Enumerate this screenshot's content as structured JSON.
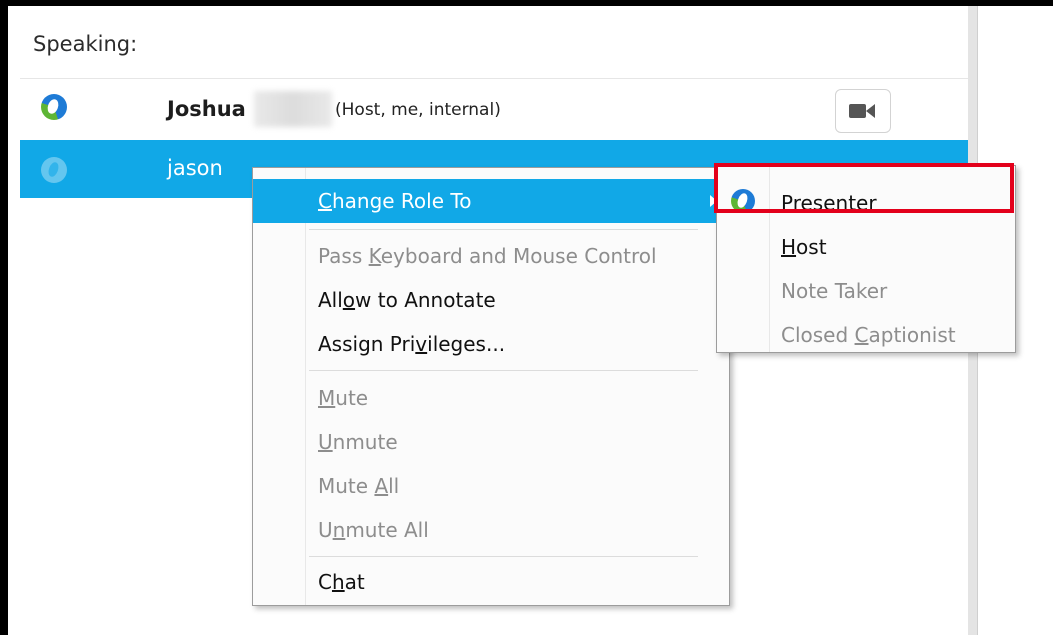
{
  "panel": {
    "heading": "Speaking:"
  },
  "participants": [
    {
      "name": "Joshua",
      "tag": "(Host, me, internal)",
      "status_icon": "webex-presenter-icon",
      "video_icon": "video-camera-icon"
    },
    {
      "name": "jason",
      "status_icon": "webex-attendee-icon",
      "selected": true
    }
  ],
  "context_menu": {
    "items": [
      {
        "key": "change_role",
        "label": "Change Role To",
        "mnemonic_index": 0,
        "enabled": true,
        "has_submenu": true,
        "highlighted": true
      },
      {
        "key": "pass_control",
        "label": "Pass Keyboard and Mouse Control",
        "mnemonic_index": 5,
        "enabled": false
      },
      {
        "key": "allow_annotate",
        "label": "Allow to Annotate",
        "mnemonic_index": 3,
        "enabled": true
      },
      {
        "key": "assign_privileges",
        "label": "Assign Privileges...",
        "mnemonic_index": 10,
        "enabled": true
      },
      {
        "key": "mute",
        "label": "Mute",
        "mnemonic_index": 0,
        "enabled": false
      },
      {
        "key": "unmute",
        "label": "Unmute",
        "mnemonic_index": 0,
        "enabled": false
      },
      {
        "key": "mute_all",
        "label": "Mute All",
        "mnemonic_index": 5,
        "enabled": false
      },
      {
        "key": "unmute_all",
        "label": "Unmute All",
        "mnemonic_index": 1,
        "enabled": false
      },
      {
        "key": "chat",
        "label": "Chat",
        "mnemonic_index": 1,
        "enabled": true
      }
    ]
  },
  "role_submenu": {
    "items": [
      {
        "key": "presenter",
        "label": "Presenter",
        "mnemonic_index": 0,
        "enabled": true,
        "icon": "webex-presenter-icon",
        "highlighted_callout": true
      },
      {
        "key": "host",
        "label": "Host",
        "mnemonic_index": 0,
        "enabled": true
      },
      {
        "key": "note_taker",
        "label": "Note Taker",
        "mnemonic_index": -1,
        "enabled": false
      },
      {
        "key": "closed_captionist",
        "label": "Closed Captionist",
        "mnemonic_index": 7,
        "enabled": false
      }
    ]
  },
  "colors": {
    "selection": "#11a8e7",
    "callout": "#e3001b",
    "disabled_text": "#8d8d8d"
  }
}
